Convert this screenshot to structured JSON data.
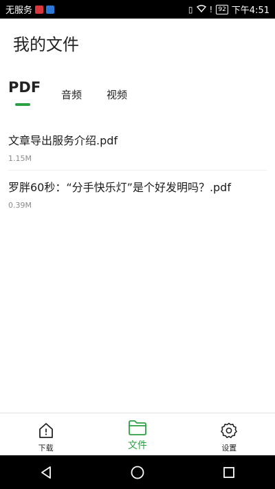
{
  "status_bar": {
    "carrier": "无服务",
    "battery": "92",
    "time": "下午4:51"
  },
  "title": "我的文件",
  "tabs": [
    {
      "label": "PDF",
      "active": true
    },
    {
      "label": "音频",
      "active": false
    },
    {
      "label": "视频",
      "active": false
    }
  ],
  "files": [
    {
      "name": "文章导出服务介绍.pdf",
      "size": "1.15M"
    },
    {
      "name": "罗胖60秒：“分手快乐灯”是个好发明吗？.pdf",
      "size": "0.39M"
    }
  ],
  "bottom_nav": [
    {
      "label": "下载",
      "icon": "download-home-icon",
      "active": false
    },
    {
      "label": "文件",
      "icon": "folder-icon",
      "active": true
    },
    {
      "label": "设置",
      "icon": "gear-icon",
      "active": false
    }
  ],
  "colors": {
    "accent": "#2aa043",
    "status_bar_bg": "#000000",
    "text": "#222222",
    "secondary_text": "#8a8a8a"
  }
}
